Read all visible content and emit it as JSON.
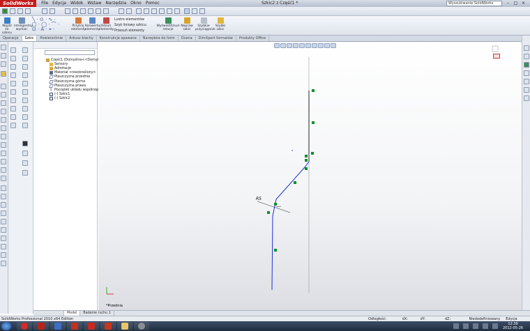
{
  "titlebar": {
    "app": "SolidWorks",
    "menu": [
      "File",
      "Edycja",
      "Widok",
      "Wstaw",
      "Narzędzia",
      "Okno",
      "Pomoc"
    ],
    "window_title": "Szkic2 z Część1 *",
    "search_placeholder": "Wyszukiwanie SolidWorks"
  },
  "commands": [
    {
      "label": "Wyjdź ze szkicu",
      "icon": "exit-sketch-icon"
    },
    {
      "label": "Inteligentny wymiar",
      "icon": "smart-dimension-icon"
    },
    {
      "label": "Przytnij elementy",
      "icon": "trim-icon"
    },
    {
      "label": "Konwertuj elementy",
      "icon": "convert-icon"
    },
    {
      "label": "Odsuń elementy",
      "icon": "offset-icon"
    },
    {
      "label": "Lustro elementów",
      "icon": "mirror-icon"
    },
    {
      "label": "Szyk liniowy szkicu",
      "icon": "linear-pattern-icon"
    },
    {
      "label": "Przesuń elementy",
      "icon": "move-icon"
    },
    {
      "label": "Wyświetl/Usuń relacje",
      "icon": "relations-icon"
    },
    {
      "label": "Napraw szkic",
      "icon": "repair-icon"
    },
    {
      "label": "Szybkie przyciąganie",
      "icon": "snap-icon"
    },
    {
      "label": "Szybki szkic",
      "icon": "rapid-sketch-icon"
    }
  ],
  "tabs": [
    "Operacje",
    "Szkic",
    "Powierzchnie",
    "Arkusz blachy",
    "Konstrukcje spawane",
    "Narzędzia do form",
    "Ocena",
    "DimXpert formatów",
    "Produkty Office"
  ],
  "active_tab": "Szkic",
  "tree": [
    {
      "label": "Część1  (Domyślna<<Domyśln",
      "icon": "part-icon",
      "color": "#c9a33a"
    },
    {
      "label": "Sensory",
      "icon": "sensor-icon",
      "color": "#e0b84a"
    },
    {
      "label": "Adnotacje",
      "icon": "annotation-icon",
      "color": "#d9a93a"
    },
    {
      "label": "Materiał <nieokreślony>",
      "icon": "material-icon",
      "color": "#5a6a88"
    },
    {
      "label": "Płaszczyzna przednia",
      "icon": "plane-icon",
      "color": "#7a8aa8"
    },
    {
      "label": "Płaszczyzna górna",
      "icon": "plane-icon",
      "color": "#7a8aa8"
    },
    {
      "label": "Płaszczyzna prawa",
      "icon": "plane-icon",
      "color": "#7a8aa8"
    },
    {
      "label": "Początek układu współrzędn",
      "icon": "origin-icon",
      "color": "#3a4a6a"
    },
    {
      "label": "(-) Szkic1",
      "icon": "sketch-icon",
      "color": "#3a4a6a"
    },
    {
      "label": "(-) Szkic2",
      "icon": "sketch-icon",
      "color": "#3a4a6a"
    }
  ],
  "graphics": {
    "dimension_label": "R5",
    "orientation_label": "*Przednia",
    "sketch_color": "#1a2fd8",
    "relation_color": "#0d8f2b"
  },
  "bottom_tabs": [
    "Model",
    "Badanie ruchu 1"
  ],
  "status": {
    "app": "SolidWorks Professional 2010 x64 Edition",
    "fields": [
      "Odległość: 18.09mm",
      "dX: 0mm",
      "dY: -13.26mm",
      "dZ: 10.69mm",
      "Niedodefiniowany",
      "Edycja Szkic2"
    ]
  },
  "clock": {
    "time": "12:39",
    "date": "2012-05-26"
  }
}
